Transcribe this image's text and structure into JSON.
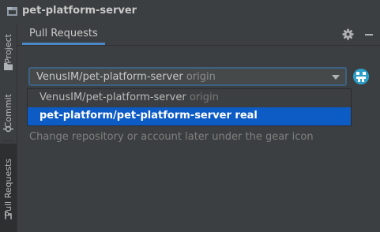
{
  "window": {
    "title": "pet-platform-server"
  },
  "tool_strip": {
    "items": [
      {
        "label": "Project",
        "icon": "folder-icon"
      },
      {
        "label": "Commit",
        "icon": "commit-icon"
      },
      {
        "label": "Pull Requests",
        "icon": "pull-request-icon"
      }
    ]
  },
  "tool_window": {
    "tab_label": "Pull Requests",
    "header_icons": [
      "gear-icon",
      "minimize-icon"
    ]
  },
  "repo_selector": {
    "selected_repo": "VenusIM/pet-platform-server",
    "selected_remote": "origin",
    "options": [
      {
        "repo": "VenusIM/pet-platform-server",
        "remote": "origin",
        "highlighted": false
      },
      {
        "repo": "pet-platform/pet-platform-server",
        "remote": "real",
        "highlighted": true
      }
    ]
  },
  "hint": "Change repository or account later under the gear icon",
  "colors": {
    "background": "#3c3f41",
    "selection": "#0d5bc5",
    "focus_border": "#3d6185",
    "tab_underline": "#4a88c7"
  }
}
